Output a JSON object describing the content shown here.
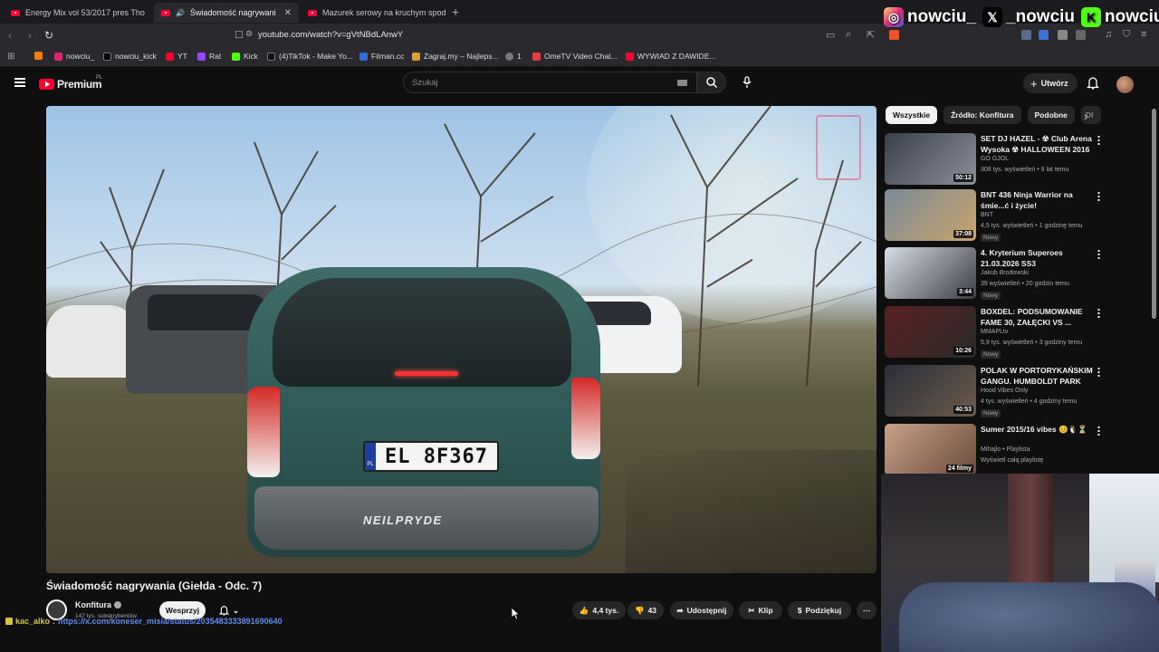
{
  "browser": {
    "tabs": [
      {
        "label": "Energy Mix vol 53/2017 pres Tho",
        "active": false
      },
      {
        "label": "Świadomość nagrywania (Gie",
        "active": true
      },
      {
        "label": "Mazurek serowy na kruchym spodzie",
        "active": false
      }
    ],
    "new_tab": "+",
    "url": "youtube.com/watch?v=gVtNBdLAnwY",
    "bookmarks": [
      {
        "label": "",
        "color": "#f57a1a",
        "icon": "rss-icon"
      },
      {
        "label": "nowciu_",
        "color": "#d62976",
        "icon": "instagram-icon"
      },
      {
        "label": "nowciu_kick",
        "color": "#000000",
        "icon": "x-icon"
      },
      {
        "label": "YT",
        "color": "#ff0033",
        "icon": "youtube-icon"
      },
      {
        "label": "Rat",
        "color": "#9146ff",
        "icon": "twitch-icon"
      },
      {
        "label": "Kick",
        "color": "#53fc18",
        "icon": "kick-icon"
      },
      {
        "label": "(4)TikTok - Make Yo...",
        "color": "#111111",
        "icon": "tiktok-icon"
      },
      {
        "label": "Filman.cc",
        "color": "#2a6ee0",
        "icon": "globe-icon"
      },
      {
        "label": "Zagraj.my – Najleps...",
        "color": "#e0a030",
        "icon": "person-icon"
      },
      {
        "label": "1",
        "color": "#777777",
        "icon": "globe-icon"
      },
      {
        "label": "OmeTV Video Chat...",
        "color": "#e04040",
        "icon": "chat-icon"
      },
      {
        "label": "WYWIAD Z DAWIDE...",
        "color": "#ff0033",
        "icon": "youtube-icon"
      }
    ]
  },
  "socials": [
    {
      "handle": "nowciu_",
      "icon": "instagram-icon",
      "color": "#d62976"
    },
    {
      "handle": "_nowciu",
      "icon": "x-icon",
      "color": "#000000"
    },
    {
      "handle": "nowciu",
      "icon": "kick-icon",
      "color": "#53fc18"
    }
  ],
  "youtube": {
    "logo_text": "Premium",
    "country": "PL",
    "search_placeholder": "Szukaj",
    "create_label": "Utwórz"
  },
  "video": {
    "title": "Świadomość nagrywania (Giełda - Odc. 7)",
    "plate": "EL 8F367",
    "plate_country": "PL",
    "badge_text": "NEILPRYDE",
    "channel": "Konfitura",
    "subscribers": "147 tys. subskrybentów",
    "actions": {
      "support": "Wesprzyj",
      "likes": "4,4 tys.",
      "dislikes": "43",
      "share": "Udostępnij",
      "clip": "Klip",
      "thanks": "Podziękuj"
    }
  },
  "chat": {
    "user": "kac_alko",
    "message": "https://x.com/koneser_misia/status/2035483333891690640"
  },
  "sidebar": {
    "chips": [
      "Wszystkie",
      "Źródło: Konfitura",
      "Podobne",
      "Dl"
    ],
    "recommendations": [
      {
        "title": "SET DJ HAZEL - ☢ Club Arena Wysoka ☢ HALLOWEEN 2016 ...",
        "channel": "GO GJOL",
        "meta": "308 tys. wyświetleń • 9 lat temu",
        "duration": "50:12",
        "new": "",
        "thumb": [
          "#3a3f4a",
          "#8a8f99"
        ]
      },
      {
        "title": "BNT 436 Ninja Warrior na śmie...ć i życie!",
        "channel": "BNT",
        "meta": "4,5 tys. wyświetleń • 1 godzinę temu",
        "duration": "37:08",
        "new": "Nowy",
        "thumb": [
          "#7a8a9a",
          "#c9a46a"
        ]
      },
      {
        "title": "4. Kryterium Superoes 21.03.2026 SS3",
        "channel": "Jakub Brodowski",
        "meta": "39 wyświetleń • 20 godzin temu",
        "duration": "3:44",
        "new": "Nowy",
        "thumb": [
          "#d8dde3",
          "#3b3f45"
        ]
      },
      {
        "title": "BOXDEL: PODSUMOWANIE FAME 30, ZAŁĘCKI VS ...",
        "channel": "MMAPLtv",
        "meta": "5,9 tys. wyświetleń • 3 godziny temu",
        "duration": "10:26",
        "new": "Nowy",
        "thumb": [
          "#5a2020",
          "#2a2a2a"
        ]
      },
      {
        "title": "POLAK W PORTORYKAŃSKIM GANGU. HUMBOLDT PARK",
        "channel": "Hood Vibes Only",
        "meta": "4 tys. wyświetleń • 4 godziny temu",
        "duration": "40:53",
        "new": "Nowy",
        "thumb": [
          "#2a2f3a",
          "#6b5a4a"
        ]
      },
      {
        "title": "Sumer 2015/16 vibes 😊🐧⏳",
        "channel": "Mihajlo • Playlista",
        "meta": "Wyświetl całą playlistę",
        "duration": "24 filmy",
        "new": "",
        "thumb": [
          "#c7a28a",
          "#6a4a3a"
        ]
      }
    ]
  }
}
